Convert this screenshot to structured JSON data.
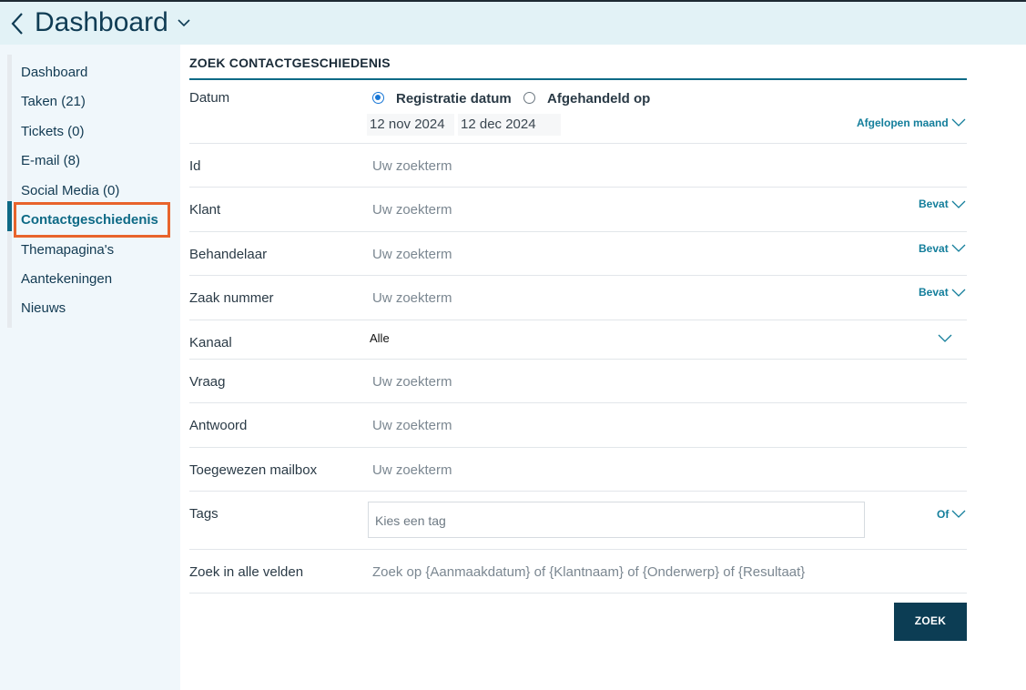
{
  "header": {
    "title": "Dashboard"
  },
  "sidebar": {
    "items": [
      {
        "label": "Dashboard"
      },
      {
        "label": "Taken (21)"
      },
      {
        "label": "Tickets (0)"
      },
      {
        "label": "E-mail (8)"
      },
      {
        "label": "Social Media (0)"
      },
      {
        "label": "Contactgeschiedenis",
        "active": true
      },
      {
        "label": "Themapagina's"
      },
      {
        "label": "Aantekeningen"
      },
      {
        "label": "Nieuws"
      }
    ]
  },
  "form": {
    "title": "ZOEK CONTACTGESCHIEDENIS",
    "datum": {
      "label": "Datum",
      "radio_registratie": "Registratie datum",
      "radio_afgehandeld": "Afgehandeld op",
      "selected": "Registratie datum",
      "from": "12 nov 2024",
      "to": "12 dec 2024",
      "range": "Afgelopen maand"
    },
    "id": {
      "label": "Id",
      "placeholder": "Uw zoekterm"
    },
    "klant": {
      "label": "Klant",
      "placeholder": "Uw zoekterm",
      "modifier": "Bevat"
    },
    "behandelaar": {
      "label": "Behandelaar",
      "placeholder": "Uw zoekterm",
      "modifier": "Bevat"
    },
    "zaak_nummer": {
      "label": "Zaak nummer",
      "placeholder": "Uw zoekterm",
      "modifier": "Bevat"
    },
    "kanaal": {
      "label": "Kanaal",
      "value": "Alle"
    },
    "vraag": {
      "label": "Vraag",
      "placeholder": "Uw zoekterm"
    },
    "antwoord": {
      "label": "Antwoord",
      "placeholder": "Uw zoekterm"
    },
    "mailbox": {
      "label": "Toegewezen mailbox",
      "placeholder": "Uw zoekterm"
    },
    "tags": {
      "label": "Tags",
      "placeholder": "Kies een tag",
      "modifier": "Of"
    },
    "alle_velden": {
      "label": "Zoek in alle velden",
      "placeholder": "Zoek op {Aanmaakdatum} of {Klantnaam} of {Onderwerp} of {Resultaat}"
    },
    "submit": "ZOEK"
  },
  "colors": {
    "accent": "#0e6a86",
    "highlight": "#e8642c",
    "button": "#0c3d54",
    "header_bg": "#e2f2f6"
  }
}
